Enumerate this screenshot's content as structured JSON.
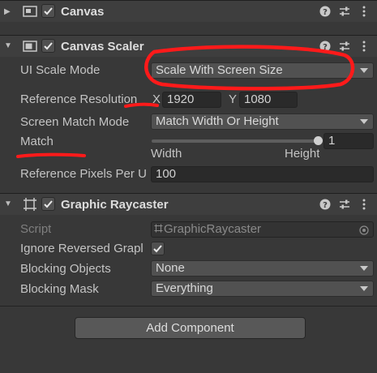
{
  "canvas": {
    "title": "Canvas"
  },
  "canvas_scaler": {
    "title": "Canvas Scaler",
    "ui_scale_mode": {
      "label": "UI Scale Mode",
      "value": "Scale With Screen Size"
    },
    "reference_resolution": {
      "label": "Reference Resolution",
      "x_label": "X",
      "x_value": "1920",
      "y_label": "Y",
      "y_value": "1080"
    },
    "screen_match_mode": {
      "label": "Screen Match Mode",
      "value": "Match Width Or Height"
    },
    "match": {
      "label": "Match",
      "value": "1",
      "fraction": 1.0,
      "min_label": "Width",
      "max_label": "Height"
    },
    "reference_pixels_per_unit": {
      "label": "Reference Pixels Per U",
      "value": "100"
    }
  },
  "graphic_raycaster": {
    "title": "Graphic Raycaster",
    "script": {
      "label": "Script",
      "value": "GraphicRaycaster"
    },
    "ignore_reversed": {
      "label": "Ignore Reversed Grapl",
      "checked": true
    },
    "blocking_objects": {
      "label": "Blocking Objects",
      "value": "None"
    },
    "blocking_mask": {
      "label": "Blocking Mask",
      "value": "Everything"
    }
  },
  "add_component": {
    "label": "Add Component"
  },
  "annotation": {
    "color": "#ff1a1a"
  }
}
